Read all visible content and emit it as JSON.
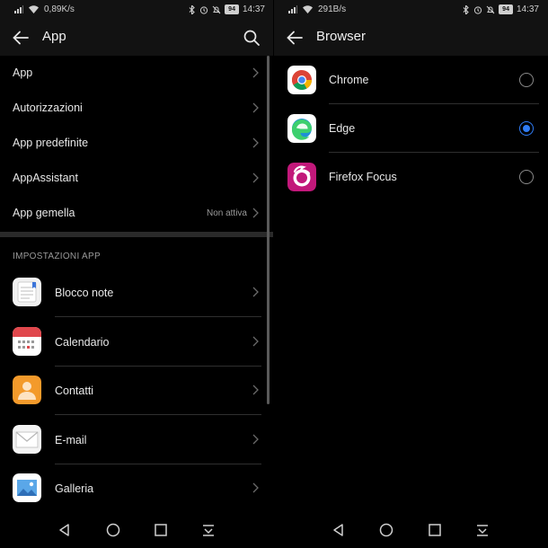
{
  "left": {
    "status": {
      "speed": "0,89K/s",
      "battery": "94",
      "time": "14:37"
    },
    "title": "App",
    "menu": [
      {
        "label": "App",
        "value": ""
      },
      {
        "label": "Autorizzazioni",
        "value": ""
      },
      {
        "label": "App predefinite",
        "value": ""
      },
      {
        "label": "AppAssistant",
        "value": ""
      },
      {
        "label": "App gemella",
        "value": "Non attiva"
      }
    ],
    "section": "IMPOSTAZIONI APP",
    "apps": [
      {
        "label": "Blocco note",
        "icon": "notepad-icon"
      },
      {
        "label": "Calendario",
        "icon": "calendar-icon"
      },
      {
        "label": "Contatti",
        "icon": "contacts-icon"
      },
      {
        "label": "E-mail",
        "icon": "mail-icon"
      },
      {
        "label": "Galleria",
        "icon": "gallery-icon"
      }
    ]
  },
  "right": {
    "status": {
      "speed": "291B/s",
      "battery": "94",
      "time": "14:37"
    },
    "title": "Browser",
    "browsers": [
      {
        "label": "Chrome",
        "icon": "chrome-icon",
        "selected": false
      },
      {
        "label": "Edge",
        "icon": "edge-icon",
        "selected": true
      },
      {
        "label": "Firefox Focus",
        "icon": "firefox-focus-icon",
        "selected": false
      }
    ]
  },
  "colors": {
    "accent": "#2f7cf6",
    "bar": "#121212",
    "background": "#000000"
  }
}
